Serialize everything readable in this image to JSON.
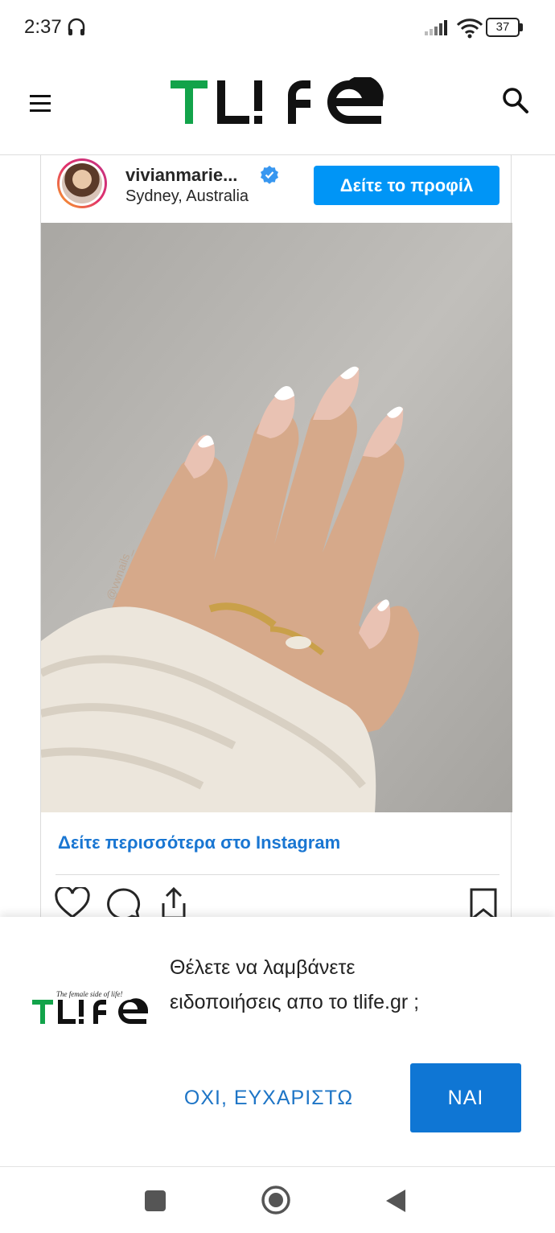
{
  "status_bar": {
    "time": "2:37",
    "battery": "37"
  },
  "header": {
    "logo_text": "TL!FE"
  },
  "instagram": {
    "username": "vivianmarie...",
    "location": "Sydney, Australia",
    "view_profile_label": "Δείτε το προφίλ",
    "photo_watermark": "@vwnails_",
    "see_more_label": "Δείτε περισσότερα στο Instagram"
  },
  "notification_prompt": {
    "logo_tagline": "The female side of life!",
    "logo_text": "TL!FE",
    "message_line1": "Θέλετε να λαμβάνετε",
    "message_line2": "ειδοποιήσεις απο το tlife.gr ;",
    "no_label": "ΟΧΙ, ΕΥΧΑΡΙΣΤΩ",
    "yes_label": "ΝΑΙ"
  },
  "colors": {
    "brand_green": "#12a34a",
    "instagram_blue": "#0095f6",
    "link_blue": "#1976d2",
    "prompt_button_blue": "#0f76d4"
  }
}
